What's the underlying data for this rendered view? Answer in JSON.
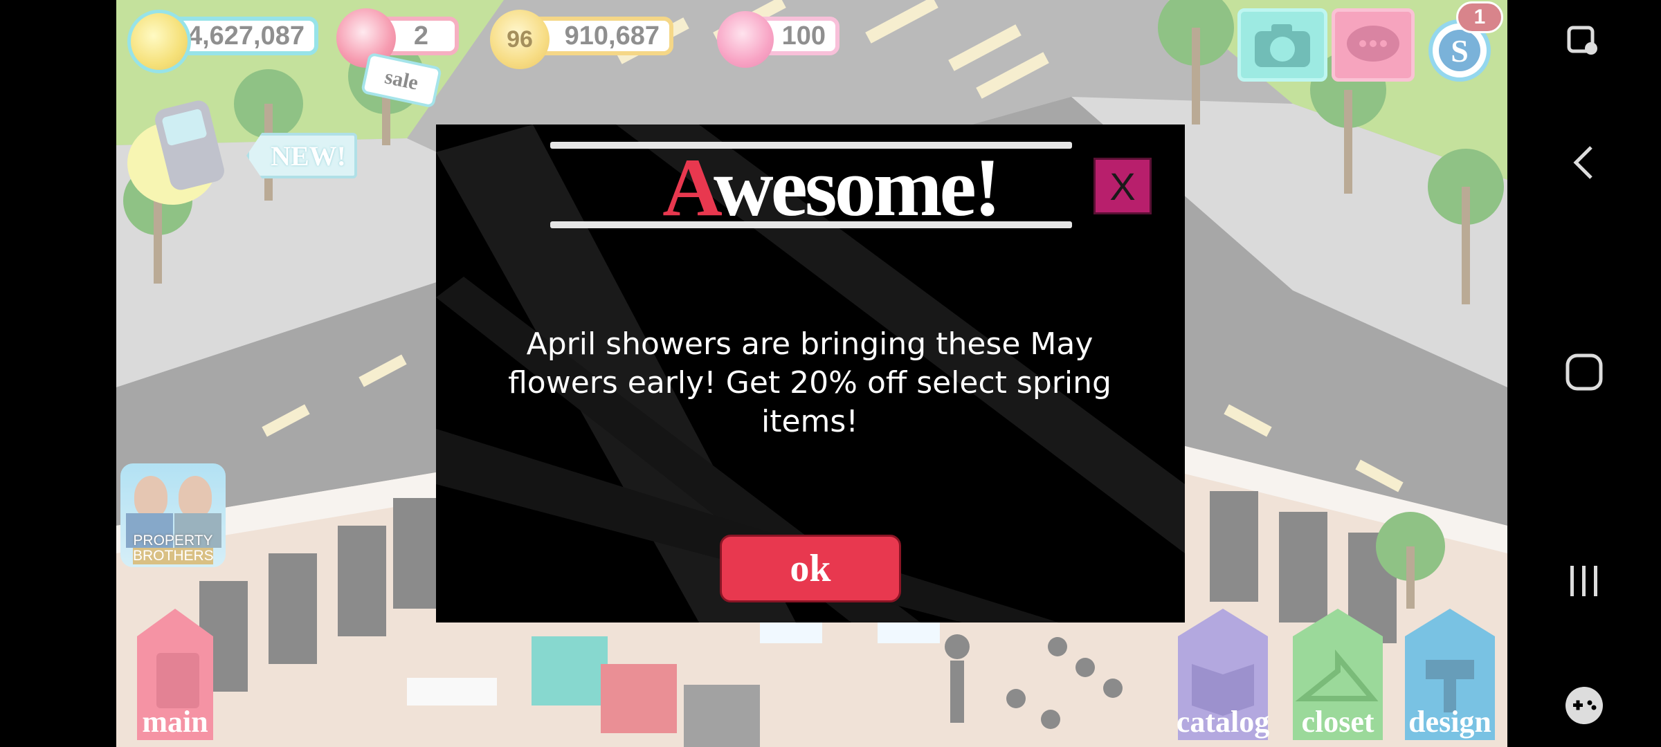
{
  "hud": {
    "coins": "14,627,087",
    "gems": "2",
    "sale_tag": "sale",
    "level": "96",
    "xp": "910,687",
    "hearts": "100",
    "notification_count": "1"
  },
  "phone_badge": "NEW!",
  "property_brothers": {
    "line1": "PROPERTY",
    "line2": "BROTHERS"
  },
  "modal": {
    "title_first_letter": "A",
    "title_rest": "wesome!",
    "message": "April showers are bringing these May flowers early! Get 20% off select spring items!",
    "ok_label": "ok",
    "close_label": "X"
  },
  "bottom_buttons": {
    "main": "main",
    "catalog": "catalog",
    "closet": "closet",
    "design": "design"
  },
  "colors": {
    "accent_red": "#e8384f",
    "close_magenta": "#b81f6c",
    "catalog_purple": "#8f7fd0",
    "closet_green": "#6cc76a",
    "design_blue": "#3aa6d6",
    "main_pink": "#f0607a"
  },
  "icons": [
    "coin-icon",
    "gem-icon",
    "level-star-icon",
    "heart-icon",
    "camera-icon",
    "chat-icon",
    "currency-s-icon",
    "phone-icon",
    "screenshot-icon",
    "back-icon",
    "home-icon",
    "recents-icon",
    "gamepad-icon"
  ]
}
